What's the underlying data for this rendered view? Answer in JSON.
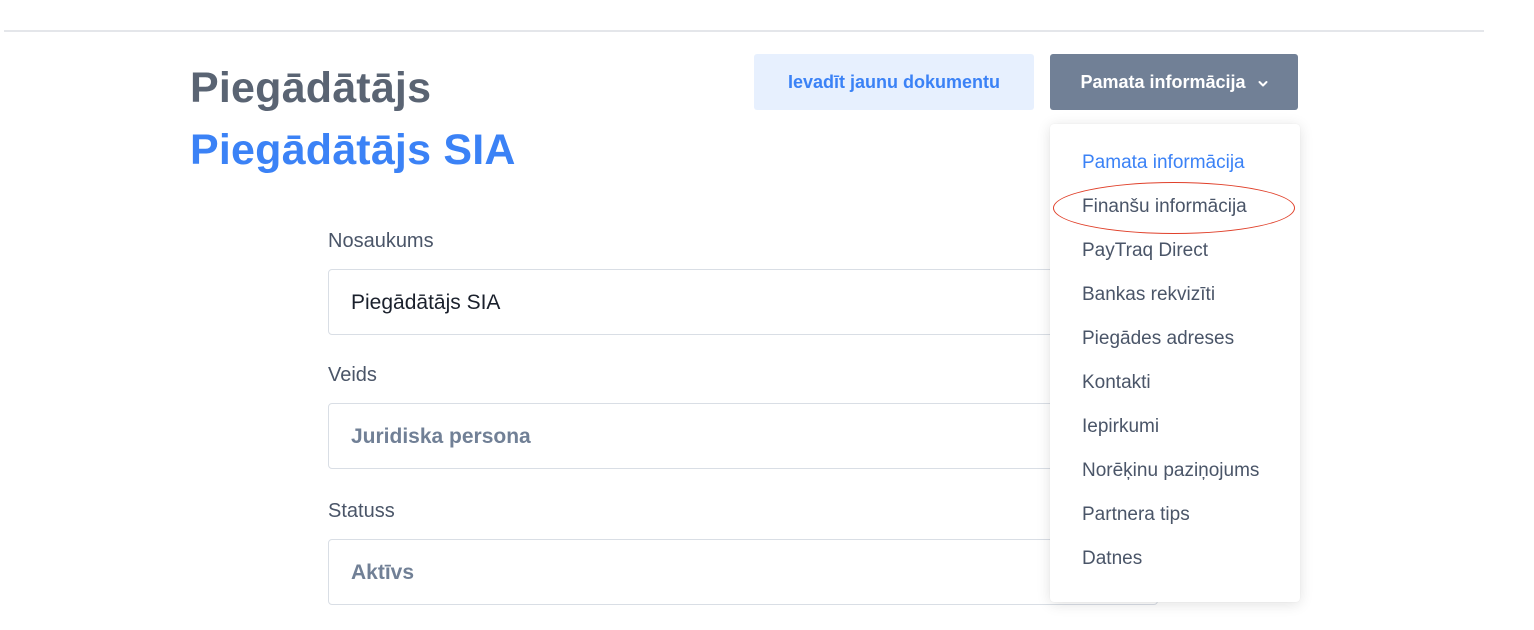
{
  "header": {
    "entity_type": "Piegādātājs",
    "entity_name": "Piegādātājs SIA"
  },
  "toolbar": {
    "new_document_label": "Ievadīt jaunu dokumentu",
    "section_label": "Pamata informācija",
    "section_icon": "chevron-down-icon"
  },
  "form": {
    "name_label": "Nosaukums",
    "name_value": "Piegādātājs SIA",
    "type_label": "Veids",
    "type_value": "Juridiska persona",
    "status_label": "Statuss",
    "status_value": "Aktīvs"
  },
  "dropdown": {
    "items": [
      {
        "label": "Pamata informācija",
        "active": true
      },
      {
        "label": "Finanšu informācija",
        "highlighted": true
      },
      {
        "label": "PayTraq Direct"
      },
      {
        "label": "Bankas rekvizīti"
      },
      {
        "label": "Piegādes adreses"
      },
      {
        "label": "Kontakti"
      },
      {
        "label": "Iepirkumi"
      },
      {
        "label": "Norēķinu paziņojums"
      },
      {
        "label": "Partnera tips"
      },
      {
        "label": "Datnes"
      }
    ]
  },
  "colors": {
    "accent": "#3b82f6",
    "heading": "#5a6473",
    "section_button": "#718096",
    "new_doc_button_bg": "#e7f0fe",
    "annotation": "#e0402a"
  }
}
